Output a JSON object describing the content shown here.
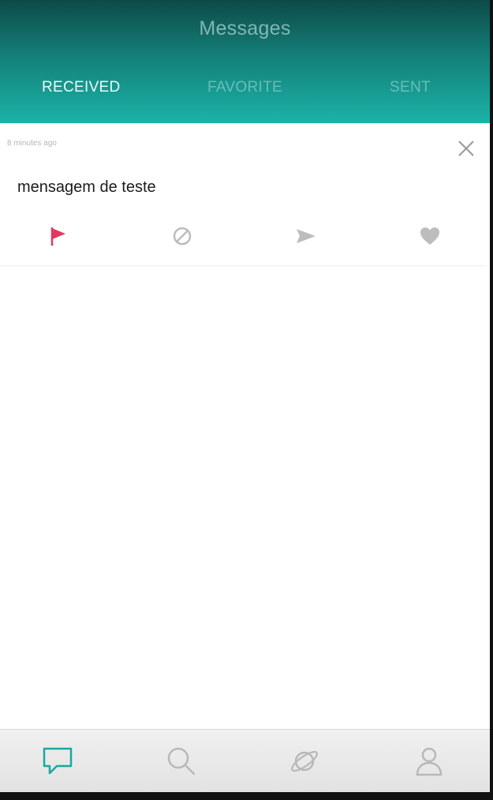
{
  "header": {
    "title": "Messages",
    "tabs": [
      {
        "label": "RECEIVED",
        "active": true
      },
      {
        "label": "FAVORITE",
        "active": false
      },
      {
        "label": "SENT",
        "active": false
      }
    ]
  },
  "message": {
    "timestamp": "8 minutes ago",
    "text": "mensagem de teste",
    "actions": [
      "flag-icon",
      "block-icon",
      "send-icon",
      "heart-icon"
    ]
  },
  "bottom_nav": {
    "items": [
      "chat-bubble-icon",
      "search-icon",
      "planet-icon",
      "user-icon"
    ],
    "active": "chat-bubble-icon"
  },
  "colors": {
    "header_top": "#0d4a48",
    "header_bottom": "#1bb3a8",
    "accent": "#1aa99c",
    "flag": "#e0385f",
    "icon_gray": "#bdbdbd"
  }
}
